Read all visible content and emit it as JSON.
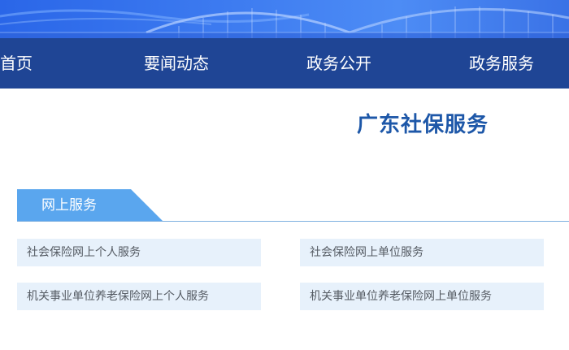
{
  "nav": {
    "items": [
      {
        "label": "首页"
      },
      {
        "label": "要闻动态"
      },
      {
        "label": "政务公开"
      },
      {
        "label": "政务服务"
      }
    ]
  },
  "main": {
    "title": "广东社保服务",
    "section": {
      "label": "网上服务",
      "items": [
        {
          "label": "社会保险网上个人服务"
        },
        {
          "label": "社会保险网上单位服务"
        },
        {
          "label": "机关事业单位养老保险网上个人服务"
        },
        {
          "label": "机关事业单位养老保险网上单位服务"
        }
      ]
    }
  },
  "colors": {
    "nav_bg": "#1f4595",
    "title": "#1d57a8",
    "tab_bg": "#5aa6ee",
    "item_bg": "#e7f1fb"
  }
}
